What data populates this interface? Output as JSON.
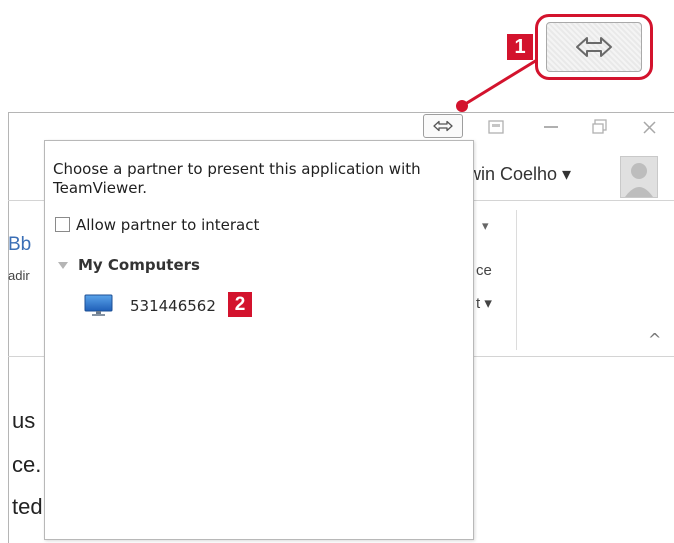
{
  "callout": {
    "badge_1": "1",
    "badge_2": "2",
    "accent_color": "#d3132d"
  },
  "window": {
    "controls": [
      "⇔",
      "restore-down",
      "minimize",
      "maximize",
      "close"
    ],
    "user_name": "rwin Coelho ▾",
    "ribbon_fragments": {
      "styles_sample": "Bb",
      "styles_caption": "adir",
      "right_top": "▾",
      "right_mid": "ce",
      "right_bottom": "t ▾",
      "collapse_glyph": "^"
    },
    "doc_fragments": [
      "us",
      "ce.",
      "ted"
    ]
  },
  "panel": {
    "message": "Choose a partner to present this application with TeamViewer.",
    "checkbox_label": "Allow partner to interact",
    "checkbox_checked": false,
    "group_label": "My Computers",
    "computers": [
      {
        "id": "531446562",
        "icon": "monitor-icon"
      }
    ]
  }
}
